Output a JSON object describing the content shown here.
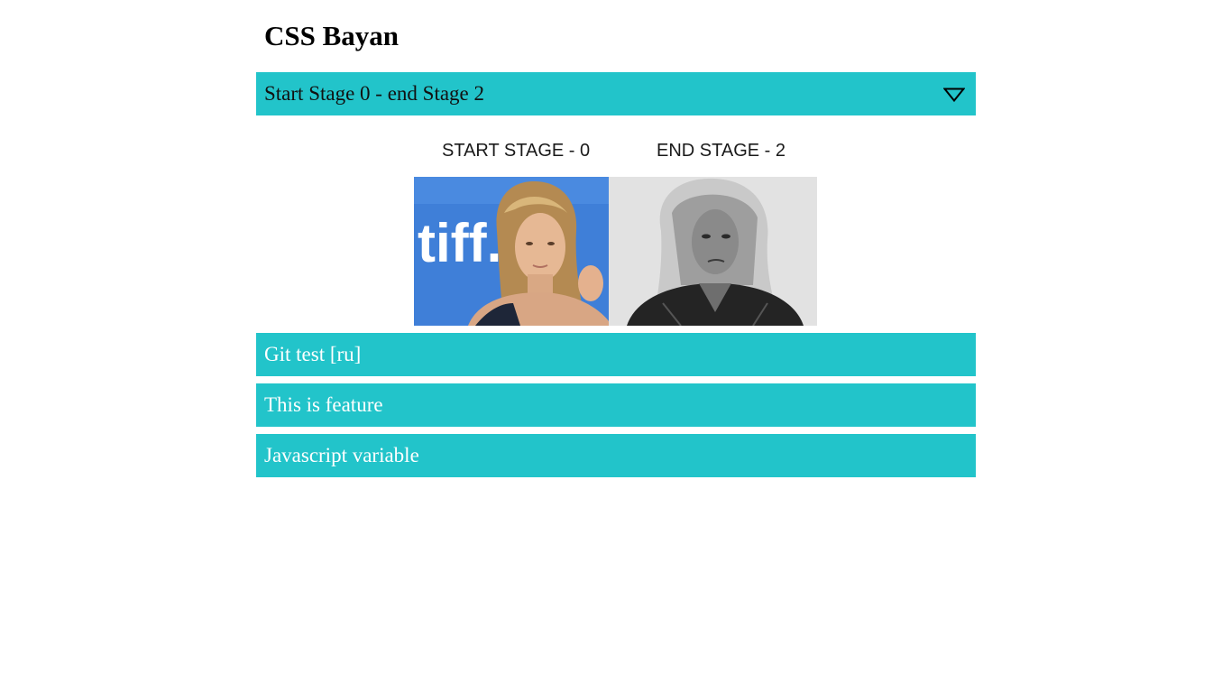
{
  "page": {
    "title": "CSS Bayan"
  },
  "accordion": {
    "items": [
      {
        "label": "Start Stage 0 - end Stage 2",
        "expanded": true,
        "content": {
          "start_label": "START STAGE - 0",
          "end_label": "END STAGE - 2",
          "left_image_text": "tiff."
        }
      },
      {
        "label": "Git test [ru]",
        "expanded": false
      },
      {
        "label": "This is feature",
        "expanded": false
      },
      {
        "label": "Javascript variable",
        "expanded": false
      }
    ]
  },
  "colors": {
    "accent": "#22c4ca",
    "background": "#ffffff",
    "header_text_closed": "#ffffff",
    "header_text_open": "#111111"
  },
  "icons": {
    "toggle": "triangle-down-icon"
  }
}
